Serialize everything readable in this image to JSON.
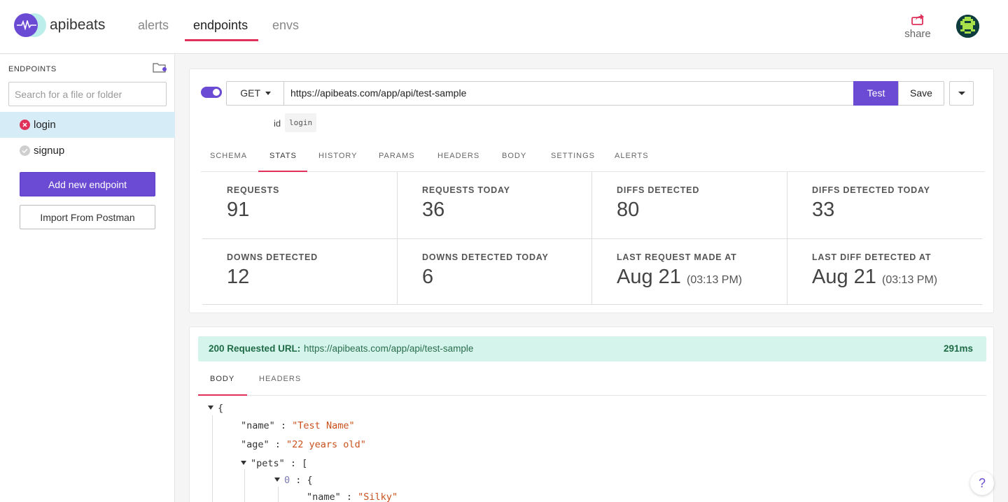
{
  "app": {
    "brand": "apibeats"
  },
  "nav": {
    "tabs": [
      "alerts",
      "endpoints",
      "envs"
    ],
    "active": "endpoints"
  },
  "header": {
    "share_label": "share"
  },
  "sidebar": {
    "title": "ENDPOINTS",
    "search_placeholder": "Search for a file or folder",
    "endpoints": [
      {
        "label": "login",
        "status": "error",
        "selected": true
      },
      {
        "label": "signup",
        "status": "ok",
        "selected": false
      }
    ],
    "add_button": "Add new endpoint",
    "import_button": "Import From Postman"
  },
  "request": {
    "enabled": true,
    "method": "GET",
    "url": "https://apibeats.com/app/api/test-sample",
    "test_label": "Test",
    "save_label": "Save",
    "id_label": "id",
    "id_value": "login"
  },
  "tabs": [
    "SCHEMA",
    "STATS",
    "HISTORY",
    "PARAMS",
    "HEADERS",
    "BODY",
    "SETTINGS",
    "ALERTS"
  ],
  "active_tab": "STATS",
  "stats": [
    {
      "label": "REQUESTS",
      "value": "91"
    },
    {
      "label": "REQUESTS TODAY",
      "value": "36"
    },
    {
      "label": "DIFFS DETECTED",
      "value": "80"
    },
    {
      "label": "DIFFS DETECTED TODAY",
      "value": "33"
    },
    {
      "label": "DOWNS DETECTED",
      "value": "12"
    },
    {
      "label": "DOWNS DETECTED TODAY",
      "value": "6"
    },
    {
      "label": "LAST REQUEST MADE AT",
      "value": "Aug 21",
      "time": "(03:13 PM)"
    },
    {
      "label": "LAST DIFF DETECTED AT",
      "value": "Aug 21",
      "time": "(03:13 PM)"
    }
  ],
  "response": {
    "status_code": "200",
    "url_label": "Requested URL:",
    "url": "https://apibeats.com/app/api/test-sample",
    "time": "291ms",
    "tabs": [
      "BODY",
      "HEADERS"
    ],
    "active_tab": "BODY",
    "body": {
      "open_brace": "{",
      "name_key": "\"name\"",
      "name_value": "\"Test Name\"",
      "age_key": "\"age\"",
      "age_value": "\"22 years old\"",
      "pets_key": "\"pets\"",
      "pets_open": "[",
      "pet0_index": "0",
      "pet0_open": "{",
      "pet0_name_key": "\"name\"",
      "pet0_name_value": "\"Silky\""
    }
  },
  "help_label": "?",
  "colors": {
    "accent": "#6b4bd3",
    "tab_underline": "#e0315a",
    "success_bg": "#d4f4ec",
    "error": "#e0315a"
  }
}
